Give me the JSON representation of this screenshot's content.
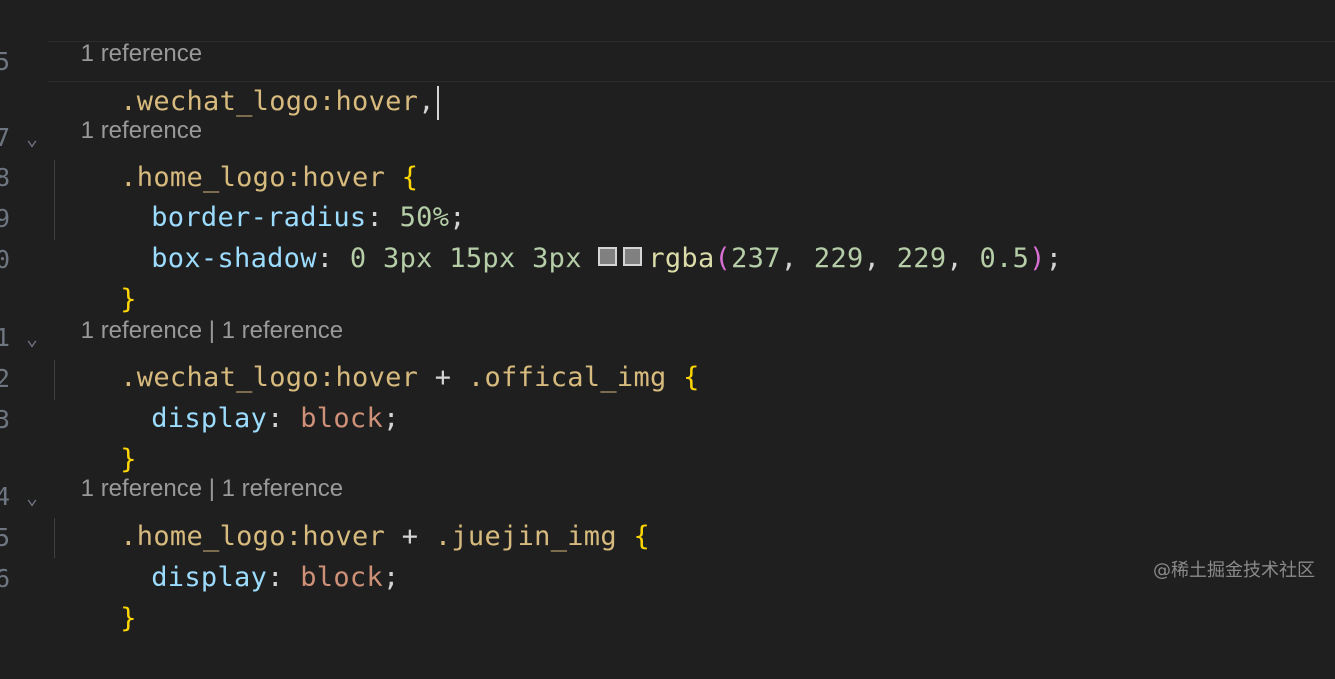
{
  "swatch_color": "#808080",
  "lens": {
    "l1": "1 reference",
    "l2": "1 reference",
    "l3a": "1 reference",
    "l3b": "1 reference",
    "l4a": "1 reference",
    "l4b": "1 reference",
    "separator": "|"
  },
  "gutter": [
    "5",
    "7",
    "8",
    "9",
    "0",
    "1",
    "2",
    "3",
    "4",
    "5",
    "6"
  ],
  "code": {
    "line1": {
      "selector": ".wechat_logo:hover",
      "comma": ","
    },
    "line2": {
      "selector": ".home_logo:hover",
      "brace": "{"
    },
    "line3": {
      "prop": "border-radius",
      "colon": ":",
      "value": "50%",
      "semi": ";"
    },
    "line4": {
      "prop": "box-shadow",
      "colon": ":",
      "v1": "0",
      "v2": "3px",
      "v3": "15px",
      "v4": "3px",
      "func": "rgba",
      "open": "(",
      "a1": "237",
      "a2": "229",
      "a3": "229",
      "a4": "0.5",
      "comma": ",",
      "close": ")",
      "semi": ";"
    },
    "line5": {
      "brace": "}"
    },
    "line6": {
      "sel1": ".wechat_logo:hover",
      "plus": "+",
      "sel2": ".offical_img",
      "brace": "{"
    },
    "line7": {
      "prop": "display",
      "colon": ":",
      "value": "block",
      "semi": ";"
    },
    "line8": {
      "brace": "}"
    },
    "line9": {
      "sel1": ".home_logo:hover",
      "plus": "+",
      "sel2": ".juejin_img",
      "brace": "{"
    },
    "line10": {
      "prop": "display",
      "colon": ":",
      "value": "block",
      "semi": ";"
    },
    "line11": {
      "brace": "}"
    }
  },
  "watermark": "@稀土掘金技术社区"
}
